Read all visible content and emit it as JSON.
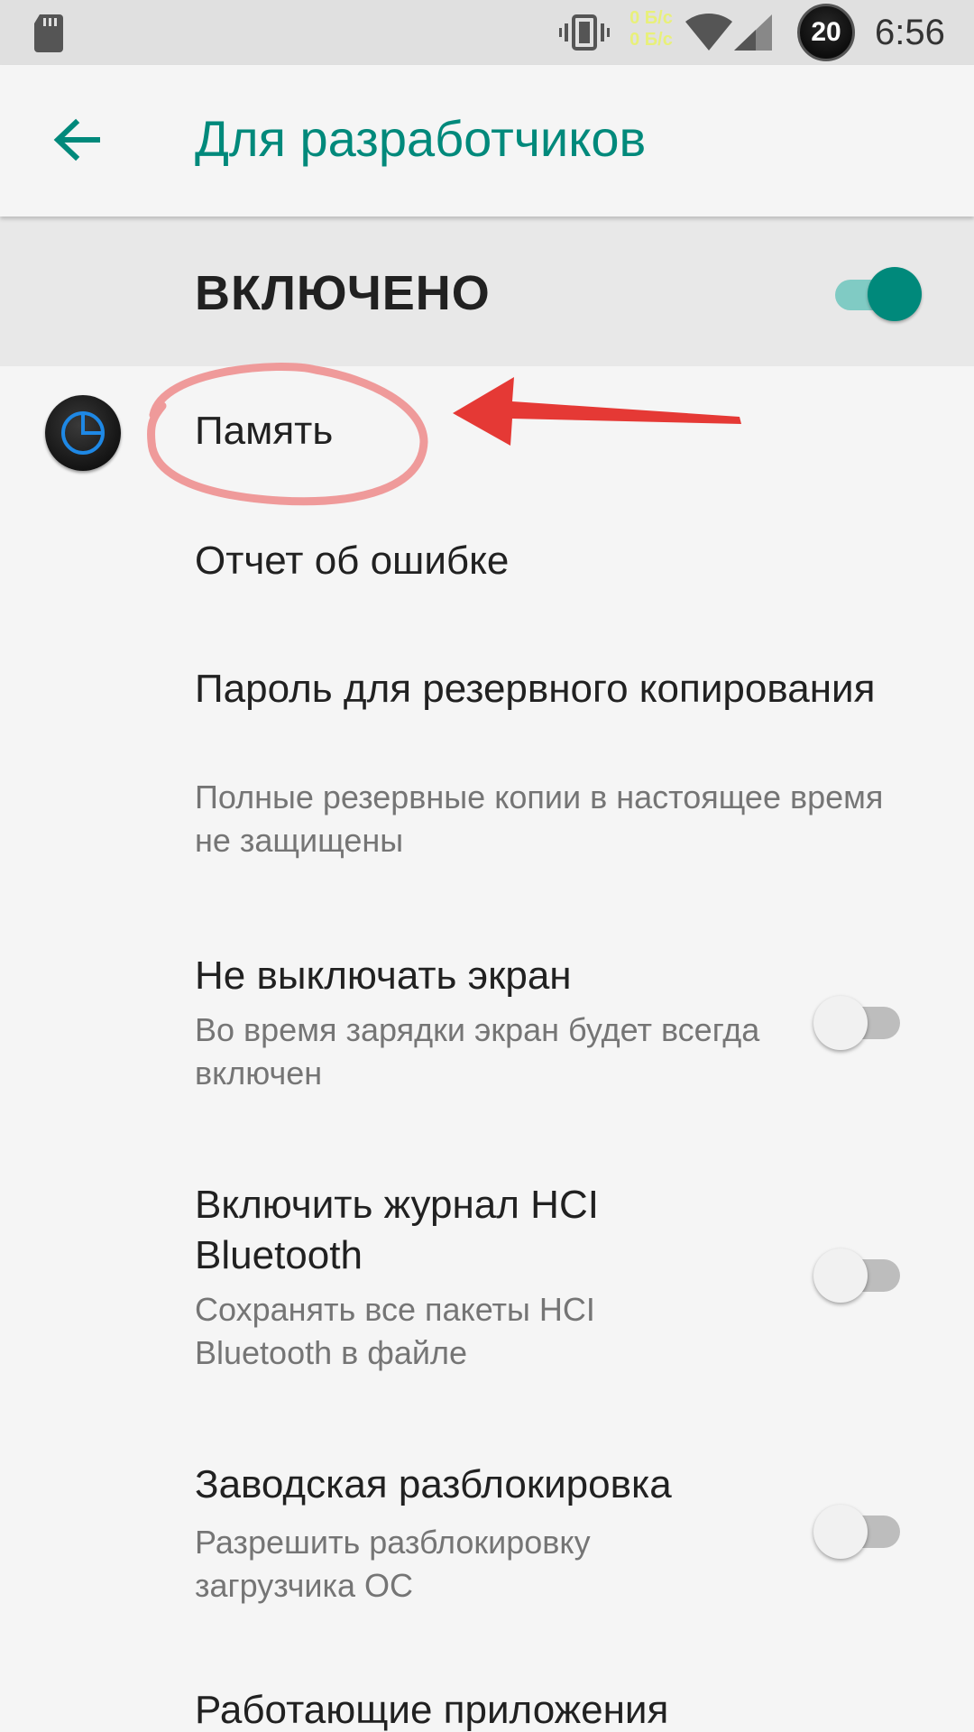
{
  "status_bar": {
    "speed_up": "0 Б/с",
    "speed_down": "0 Б/с",
    "badge": "20",
    "time": "6:56",
    "icons": [
      "sd-card-icon",
      "vibrate-icon",
      "wifi-icon",
      "signal-icon"
    ]
  },
  "app_bar": {
    "title": "Для разработчиков",
    "back_icon": "arrow-left-icon"
  },
  "master_switch": {
    "label": "ВКЛЮЧЕНО",
    "checked": true
  },
  "items": [
    {
      "title": "Память",
      "subtitle": ""
    },
    {
      "title": "Отчет об ошибке",
      "subtitle": ""
    },
    {
      "title": "Пароль для резервного копирования",
      "subtitle": "Полные резервные копии в настоящее время не защищены"
    },
    {
      "title": "Не выключать экран",
      "subtitle": "Во время зарядки экран будет всегда включен",
      "checked": false
    },
    {
      "title": "Включить журнал HCI Bluetooth",
      "subtitle": "Сохранять все пакеты HCI Bluetooth в файле",
      "checked": false
    },
    {
      "title": "Заводская разблокировка",
      "subtitle": "Разрешить разблокировку загрузчика ОС",
      "checked": false
    },
    {
      "title": "Работающие приложения",
      "subtitle": ""
    }
  ],
  "colors": {
    "accent": "#00897b",
    "accent_light": "#80cbc4",
    "annotation_circle": "#ef9a9a",
    "annotation_arrow": "#e53935"
  }
}
